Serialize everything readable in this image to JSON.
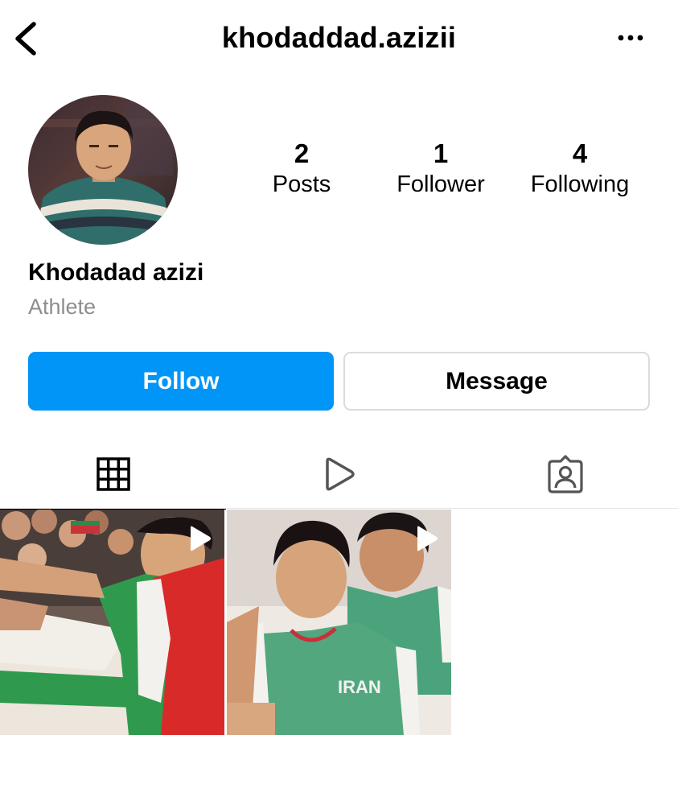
{
  "header": {
    "username": "khodaddad.azizii",
    "back_icon": "chevron-left-icon",
    "more_icon": "ellipsis-icon"
  },
  "profile": {
    "display_name": "Khodadad azizi",
    "category": "Athlete",
    "stats": [
      {
        "count": "2",
        "label": "Posts"
      },
      {
        "count": "1",
        "label": "Follower"
      },
      {
        "count": "4",
        "label": "Following"
      }
    ]
  },
  "actions": {
    "follow_label": "Follow",
    "message_label": "Message"
  },
  "tabs": [
    {
      "name": "posts-grid",
      "icon": "grid-icon",
      "active": true
    },
    {
      "name": "reels",
      "icon": "reels-play-icon",
      "active": false
    },
    {
      "name": "tagged",
      "icon": "tagged-person-icon",
      "active": false
    }
  ],
  "posts": [
    {
      "type": "video",
      "overlay_icon": "play-icon"
    },
    {
      "type": "video",
      "overlay_icon": "play-icon",
      "visible_text": "IRAN"
    }
  ],
  "colors": {
    "follow_button": "#0095f6",
    "secondary_text": "#8e8e8e",
    "button_border": "#dbdbdb"
  }
}
